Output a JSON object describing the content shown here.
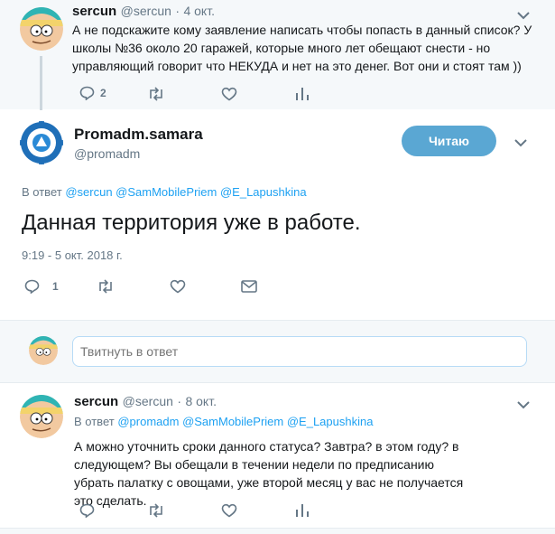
{
  "tweet1": {
    "name": "sercun",
    "handle": "@sercun",
    "dot": "·",
    "date": "4 окт.",
    "text": "А не подскажите кому заявление написать чтобы попасть в данный список? У школы №36 около 20 гаражей, которые много лет обещают снести - но управляющий говорит что НЕКУДА и нет на это денег. Вот они и стоят там ))",
    "reply_count": "2",
    "avatar_icon": "cartman-avatar-icon"
  },
  "main": {
    "name": "Promadm.samara",
    "handle": "@promadm",
    "follow_label": "Читаю",
    "in_reply_prefix": "В ответ",
    "reply_to": [
      "@sercun",
      "@SamMobilePriem",
      "@E_Lapushkina"
    ],
    "text": "Данная территория уже в работе.",
    "timestamp": "9:19 - 5 окт. 2018 г.",
    "reply_count": "1",
    "avatar_icon": "samara-gear-logo-icon"
  },
  "composer": {
    "placeholder": "Твитнуть в ответ"
  },
  "tweet3": {
    "name": "sercun",
    "handle": "@sercun",
    "dot": "·",
    "date": "8 окт.",
    "in_reply_prefix": "В ответ",
    "reply_to": [
      "@promadm",
      "@SamMobilePriem",
      "@E_Lapushkina"
    ],
    "text": "А можно уточнить сроки данного статуса? Завтра? в этом году? в следующем? Вы обещали в течении недели по предписанию убрать палатку с овощами, уже второй месяц у вас не получается это сделать."
  },
  "colors": {
    "accent": "#1da1f2",
    "follow_button": "#5aa7d3",
    "muted": "#657786",
    "band": "#f5f8fa"
  }
}
